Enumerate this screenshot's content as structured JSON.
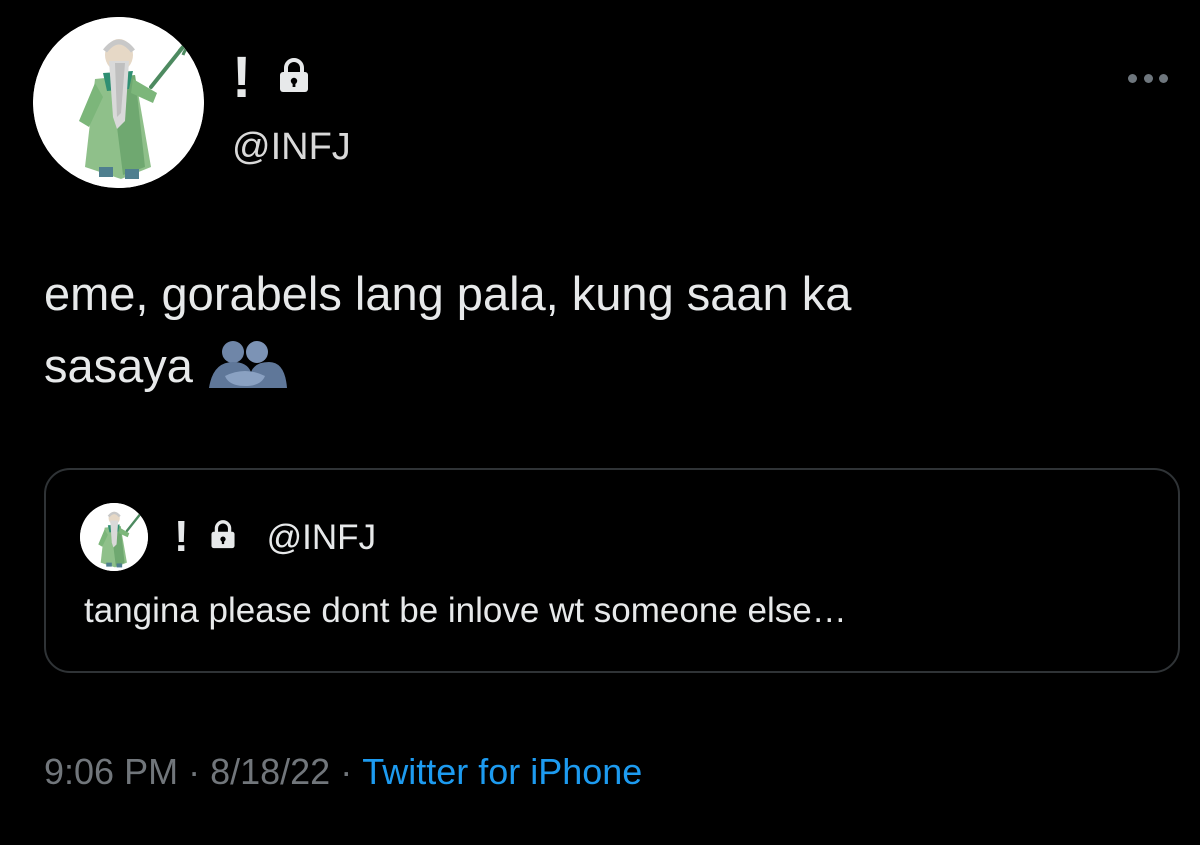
{
  "tweet": {
    "author": {
      "display_name": "!",
      "handle": "@INFJ",
      "avatar_icon": "wizard-avatar-icon",
      "protected_icon": "lock-icon"
    },
    "more_icon": "more-dots-icon",
    "text_line1": "eme, gorabels lang pala, kung saan ka",
    "text_line2": "sasaya",
    "emoji_icon": "people-hugging-emoji-icon",
    "quoted": {
      "display_name": "!",
      "handle": "@INFJ",
      "avatar_icon": "wizard-avatar-icon",
      "protected_icon": "lock-icon",
      "text": "tangina please dont be inlove wt someone else…"
    },
    "meta": {
      "time": "9:06 PM",
      "separator": "·",
      "date": "8/18/22",
      "source": "Twitter for iPhone"
    }
  },
  "colors": {
    "background": "#000000",
    "text_primary": "#e7e9ea",
    "text_secondary": "#71767b",
    "link_blue": "#1d9bf0",
    "border": "#2f3336"
  }
}
